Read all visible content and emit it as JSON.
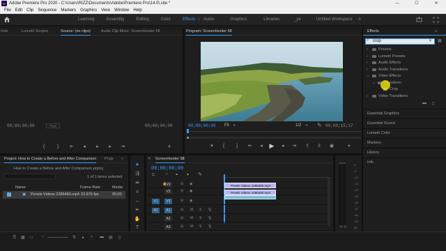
{
  "window": {
    "app_icon": "Pr",
    "title": "Adobe Premiere Pro 2020 - C:\\Users\\RIZZ\\Documents\\Adobe\\Premiere Pro\\14.0\\.site *",
    "minimize": "—",
    "maximize": "☐",
    "close": "✕"
  },
  "menu": [
    "File",
    "Edit",
    "Clip",
    "Sequence",
    "Markers",
    "Graphics",
    "View",
    "Window",
    "Help"
  ],
  "workspaces": {
    "tabs": [
      "Learning",
      "Assembly",
      "Editing",
      "Color",
      "Effects",
      "Audio",
      "Graphics",
      "Libraries",
      "_ye",
      "Untitled Workspace"
    ],
    "active": "Effects",
    "overflow": "»"
  },
  "source_panel": {
    "tabs": [
      "trols",
      "Lumetri Scopes",
      "Source: (no clips)",
      "Audio Clip Mixer: ScreenHunter 58"
    ],
    "active_tab": "Source: (no clips)",
    "timecode_left": "00;00;00;00",
    "page": "Page",
    "timecode_right": "00;00;00;00"
  },
  "program_panel": {
    "title": "Program: ScreenHunter 58",
    "timecode_left": "00;00;00;00",
    "fit": "Fit",
    "fraction": "1/2",
    "timecode_right": "00;00;15;17"
  },
  "effects_panel": {
    "title": "Effects",
    "search_value": "crop",
    "tree": [
      {
        "label": "Presets",
        "arrow": "›"
      },
      {
        "label": "Lumetri Presets",
        "arrow": "›"
      },
      {
        "label": "Audio Effects",
        "arrow": "›"
      },
      {
        "label": "Audio Transitions",
        "arrow": "›"
      },
      {
        "label": "Video Effects",
        "arrow": "⌄"
      },
      {
        "label": "Transform",
        "arrow": "⌄"
      },
      {
        "label": "Crop",
        "arrow": ""
      },
      {
        "label": "Video Transitions",
        "arrow": "›"
      }
    ],
    "sections": [
      "Essential Graphics",
      "Essential Sound",
      "Lumetri Color",
      "Markers",
      "History",
      "Info"
    ]
  },
  "project_panel": {
    "tabs": [
      "Project: How to Create a Before and After Comparison",
      "Proje"
    ],
    "active_tab": "Project: How to Create a Before and After Comparison",
    "file": "How to Create a Before and After Comparison.prproj",
    "selection": "1 of 1 items selected",
    "columns": [
      "Name",
      "Frame Rate",
      "Media"
    ],
    "rows": [
      {
        "name": "Pexels Videos 2286450.mp4",
        "frame_rate": "23.976 fps",
        "media": "00;00"
      }
    ]
  },
  "timeline": {
    "title": "ScreenHunter 58",
    "timecode": "00;00;00;00",
    "tracks": [
      {
        "label": "V3",
        "src": "",
        "kind": "video"
      },
      {
        "label": "V2",
        "src": "",
        "kind": "video"
      },
      {
        "label": "V1",
        "src": "V1",
        "kind": "video"
      },
      {
        "label": "A1",
        "src": "A1",
        "kind": "audio"
      },
      {
        "label": "A2",
        "src": "",
        "kind": "audio"
      },
      {
        "label": "A3",
        "src": "",
        "kind": "audio"
      }
    ],
    "clips": [
      {
        "label": "Pexels Videos 2286450.mp4",
        "kind": "v",
        "track": "V2"
      },
      {
        "label": "Pexels Videos 2286450.mp4",
        "kind": "v",
        "track": "V1"
      }
    ],
    "meter_labels": [
      "0",
      "-6",
      "-12",
      "-18",
      "-24",
      "-30",
      "-36",
      "-42",
      "-48",
      "-54",
      "dB"
    ]
  }
}
